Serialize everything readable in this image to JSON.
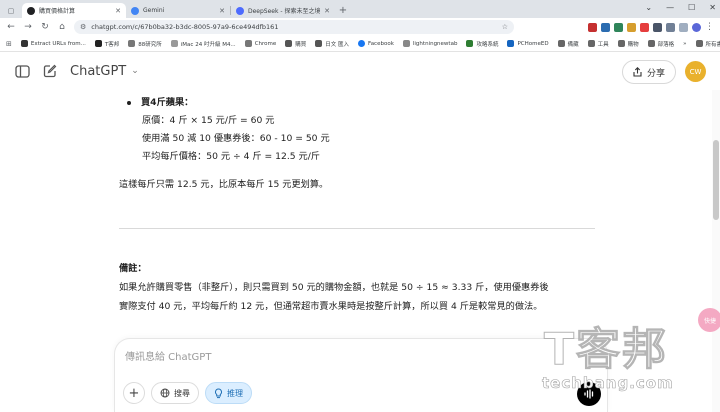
{
  "browser": {
    "tabs": [
      {
        "title": "購買價格計算",
        "active": true,
        "favicon_color": "#202124"
      },
      {
        "title": "Gemini",
        "active": false,
        "favicon_color": "#4285f4"
      },
      {
        "title": "DeepSeek - 探索未至之境",
        "active": false,
        "favicon_color": "#4d6bfe"
      }
    ],
    "new_tab": "+",
    "window_controls": [
      "⌄",
      "—",
      "☐",
      "✕"
    ],
    "url": "chatgpt.com/c/67b0ba32-b3dc-8005-97a9-6ce494dfb161",
    "bookmarks": [
      {
        "label": "Extract URLs from...",
        "color": "#333"
      },
      {
        "label": "T客邦",
        "color": "#222"
      },
      {
        "label": "88研究所",
        "color": "#777"
      },
      {
        "label": "iMac 24 吋升級 M4...",
        "color": "#999"
      },
      {
        "label": "Chrome",
        "color": "#777"
      },
      {
        "label": "購買",
        "color": "#555"
      },
      {
        "label": "日文 匯入",
        "color": "#555"
      },
      {
        "label": "Facebook",
        "color": "#1877f2"
      },
      {
        "label": "lightningnewtab",
        "color": "#888"
      },
      {
        "label": "攻略系統",
        "color": "#2e7d32"
      },
      {
        "label": "PCHomeED",
        "color": "#1565c0"
      },
      {
        "label": "備藏",
        "color": "#666"
      },
      {
        "label": "工具",
        "color": "#666"
      },
      {
        "label": "購物",
        "color": "#666"
      },
      {
        "label": "部落格",
        "color": "#666"
      }
    ],
    "bookmarks_more": "»",
    "all_bookmarks": "所有書籤"
  },
  "app": {
    "model_name": "ChatGPT",
    "share_label": "分享",
    "avatar_initials": "CW"
  },
  "message": {
    "bullet_title": "買4斤蘋果：",
    "lines": [
      "原價：4 斤 × 15 元/斤 = 60 元",
      "使用滿 50 減 10 優惠券後：60 - 10 = 50 元",
      "平均每斤價格：50 元 ÷ 4 斤 = 12.5 元/斤"
    ],
    "summary": "這樣每斤只需 12.5 元，比原本每斤 15 元更划算。",
    "note_title": "備註：",
    "note_line1": "如果允許購買零售（非整斤），則只需買到 50 元的購物金額，也就是 50 ÷ 15 ≈ 3.33 斤，使用優惠券後",
    "note_line2": "實際支付 40 元，平均每斤約 12 元，但通常超市賣水果時是按整斤計算，所以買 4 斤是較常見的做法。"
  },
  "composer": {
    "placeholder": "傳訊息給 ChatGPT",
    "add_label": "+",
    "search_label": "搜尋",
    "reason_label": "推理"
  },
  "side_badge": "快捷",
  "watermark": {
    "logo": "T客邦",
    "site": "techbang.com"
  }
}
